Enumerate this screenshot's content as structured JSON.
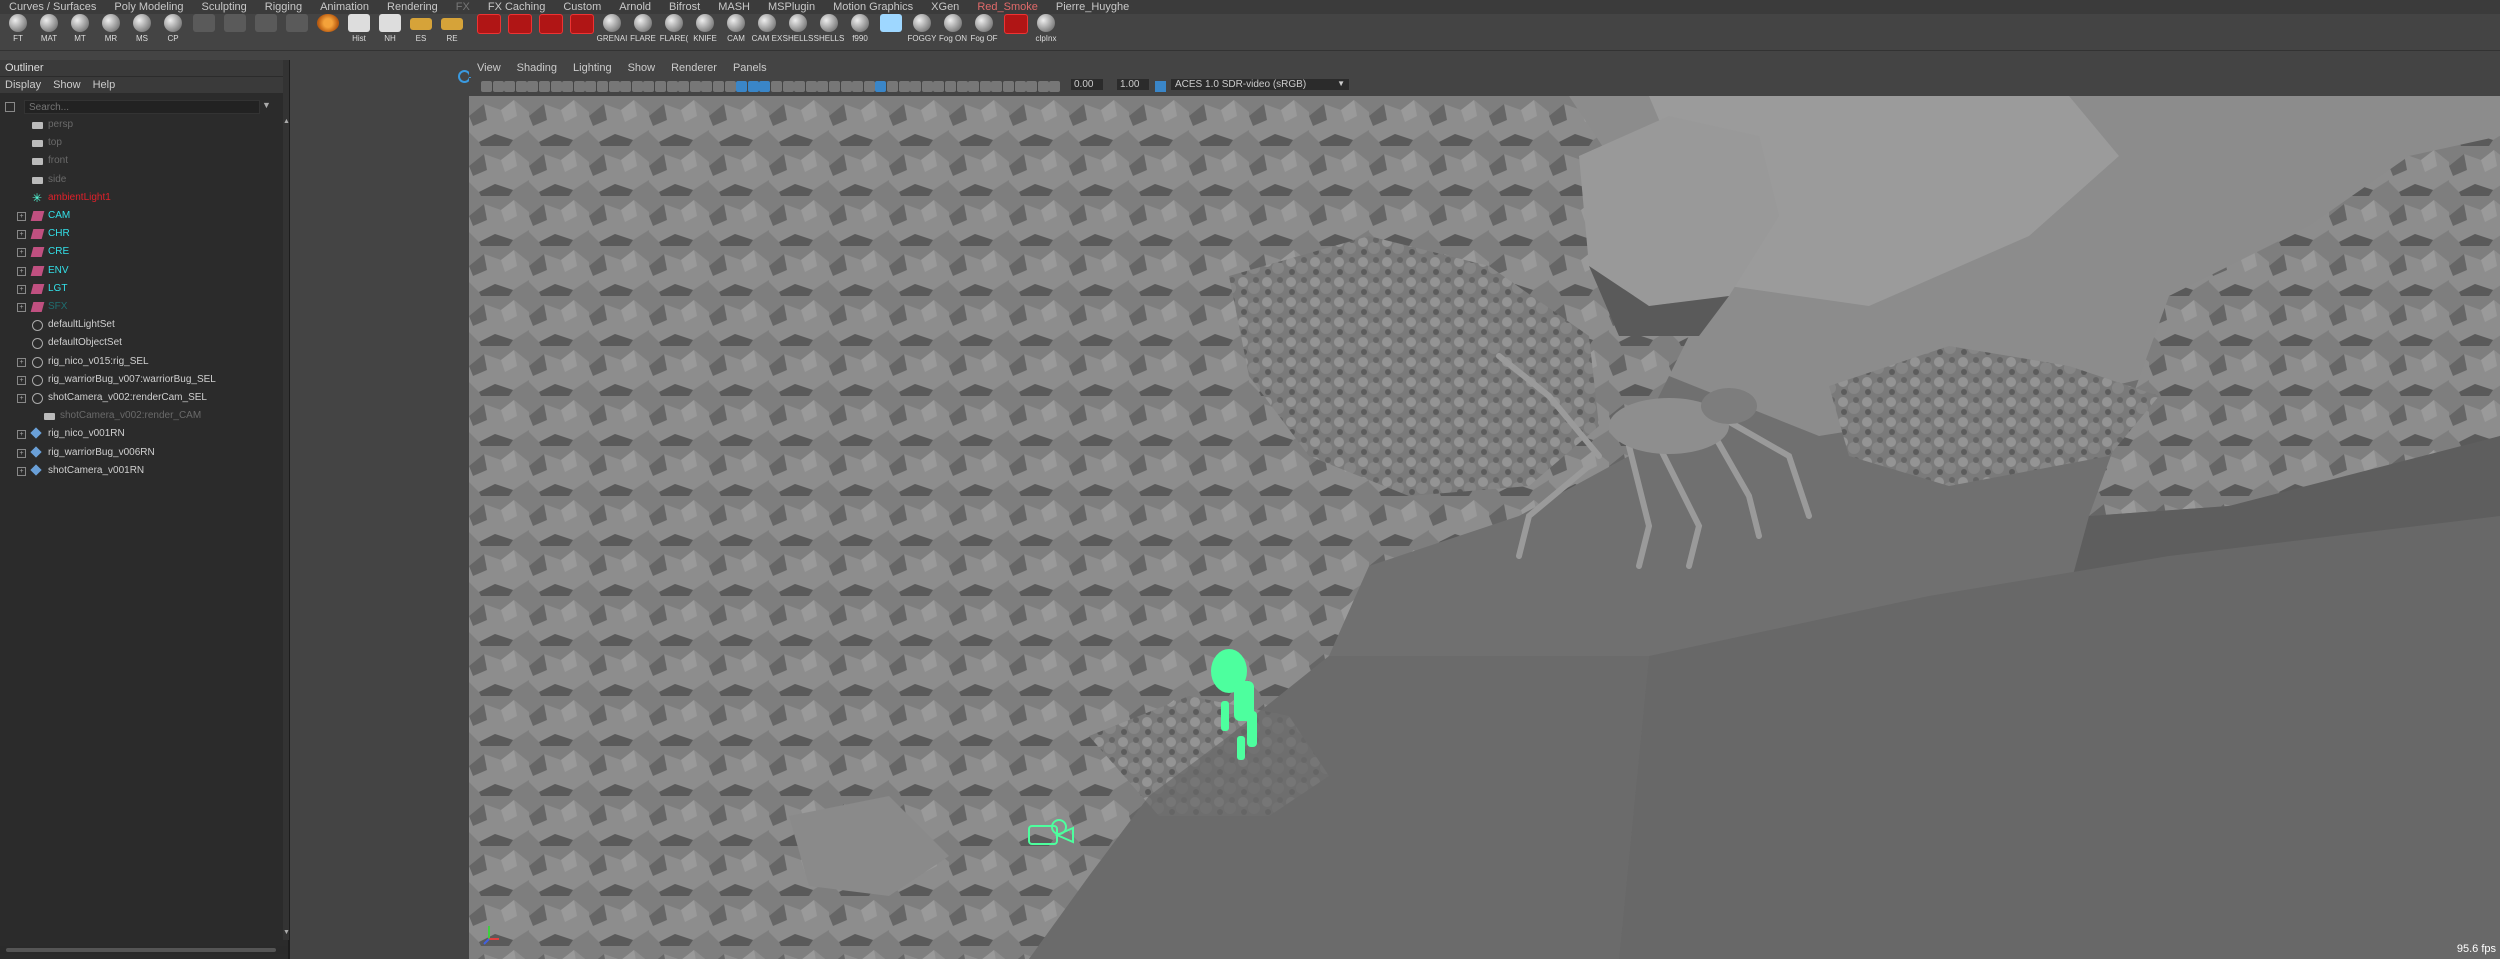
{
  "menubar": [
    "Curves / Surfaces",
    "Poly Modeling",
    "Sculpting",
    "Rigging",
    "Animation",
    "Rendering",
    "FX",
    "FX Caching",
    "Custom",
    "Arnold",
    "Bifrost",
    "MASH",
    "MSPlugin",
    "Motion Graphics",
    "XGen",
    "Red_Smoke",
    "Pierre_Huyghe"
  ],
  "shelf": [
    {
      "label": "FT",
      "icon": "sphere"
    },
    {
      "label": "MAT",
      "icon": "sphere"
    },
    {
      "label": "MT",
      "icon": "sphere"
    },
    {
      "label": "MR",
      "icon": "sphere"
    },
    {
      "label": "MS",
      "icon": "sphere"
    },
    {
      "label": "CP",
      "icon": "sphere"
    },
    {
      "label": "",
      "icon": "pen"
    },
    {
      "label": "",
      "icon": "brush"
    },
    {
      "label": "",
      "icon": "grid"
    },
    {
      "label": "",
      "icon": "cubes"
    },
    {
      "label": "",
      "icon": "orange"
    },
    {
      "label": "Hist",
      "icon": "white"
    },
    {
      "label": "NH",
      "icon": "white"
    },
    {
      "label": "ES",
      "icon": "folder"
    },
    {
      "label": "RE",
      "icon": "folder"
    },
    {
      "label": "",
      "icon": "red"
    },
    {
      "label": "",
      "icon": "red"
    },
    {
      "label": "",
      "icon": "red"
    },
    {
      "label": "",
      "icon": "red"
    },
    {
      "label": "GRENAI",
      "icon": "sphere"
    },
    {
      "label": "FLARE",
      "icon": "sphere"
    },
    {
      "label": "FLARE(",
      "icon": "sphere"
    },
    {
      "label": "KNIFE",
      "icon": "sphere"
    },
    {
      "label": "CAM",
      "icon": "sphere"
    },
    {
      "label": "CAM EX",
      "icon": "sphere"
    },
    {
      "label": "SHELLS",
      "icon": "sphere"
    },
    {
      "label": "SHELLS",
      "icon": "sphere"
    },
    {
      "label": "f990",
      "icon": "sphere"
    },
    {
      "label": "",
      "icon": "blue"
    },
    {
      "label": "FOGGY",
      "icon": "sphere"
    },
    {
      "label": "Fog ON",
      "icon": "sphere"
    },
    {
      "label": "Fog OF",
      "icon": "sphere"
    },
    {
      "label": "",
      "icon": "red"
    },
    {
      "label": "clpInx",
      "icon": "sphere"
    }
  ],
  "outliner": {
    "title": "Outliner",
    "menu": [
      "Display",
      "Show",
      "Help"
    ],
    "search_placeholder": "Search...",
    "items": [
      {
        "label": "persp",
        "icon": "camera",
        "dim": true,
        "expand": false
      },
      {
        "label": "top",
        "icon": "camera",
        "dim": true,
        "expand": false
      },
      {
        "label": "front",
        "icon": "camera",
        "dim": true,
        "expand": false
      },
      {
        "label": "side",
        "icon": "camera",
        "dim": true,
        "expand": false
      },
      {
        "label": "ambientLight1",
        "icon": "light",
        "color": "#e0202a",
        "expand": false
      },
      {
        "label": "CAM",
        "icon": "layer",
        "color": "#33e0e8",
        "expand": true
      },
      {
        "label": "CHR",
        "icon": "layer",
        "color": "#33e0e8",
        "expand": true
      },
      {
        "label": "CRE",
        "icon": "layer",
        "color": "#33e0e8",
        "expand": true
      },
      {
        "label": "ENV",
        "icon": "layer",
        "color": "#33e0e8",
        "expand": true
      },
      {
        "label": "LGT",
        "icon": "layer",
        "color": "#33e0e8",
        "expand": true
      },
      {
        "label": "SFX",
        "icon": "layer",
        "color": "#1f6e70",
        "expand": true
      },
      {
        "label": "defaultLightSet",
        "icon": "set",
        "expand": false
      },
      {
        "label": "defaultObjectSet",
        "icon": "set",
        "expand": false
      },
      {
        "label": "rig_nico_v015:rig_SEL",
        "icon": "set",
        "expand": true
      },
      {
        "label": "rig_warriorBug_v007:warriorBug_SEL",
        "icon": "set",
        "expand": true
      },
      {
        "label": "shotCamera_v002:renderCam_SEL",
        "icon": "set",
        "expand": true
      },
      {
        "label": "shotCamera_v002:render_CAM",
        "icon": "camera",
        "dim": true,
        "child": true
      },
      {
        "label": "rig_nico_v001RN",
        "icon": "ref",
        "expand": true
      },
      {
        "label": "rig_warriorBug_v006RN",
        "icon": "ref",
        "expand": true
      },
      {
        "label": "shotCamera_v001RN",
        "icon": "ref",
        "expand": true
      }
    ]
  },
  "panel_menu": [
    "View",
    "Shading",
    "Lighting",
    "Show",
    "Renderer",
    "Panels"
  ],
  "toolbar": {
    "value_a": "0.00",
    "value_b": "1.00",
    "colorspace": "ACES 1.0 SDR-video (sRGB)"
  },
  "viewport": {
    "fps": "95.6 fps"
  }
}
